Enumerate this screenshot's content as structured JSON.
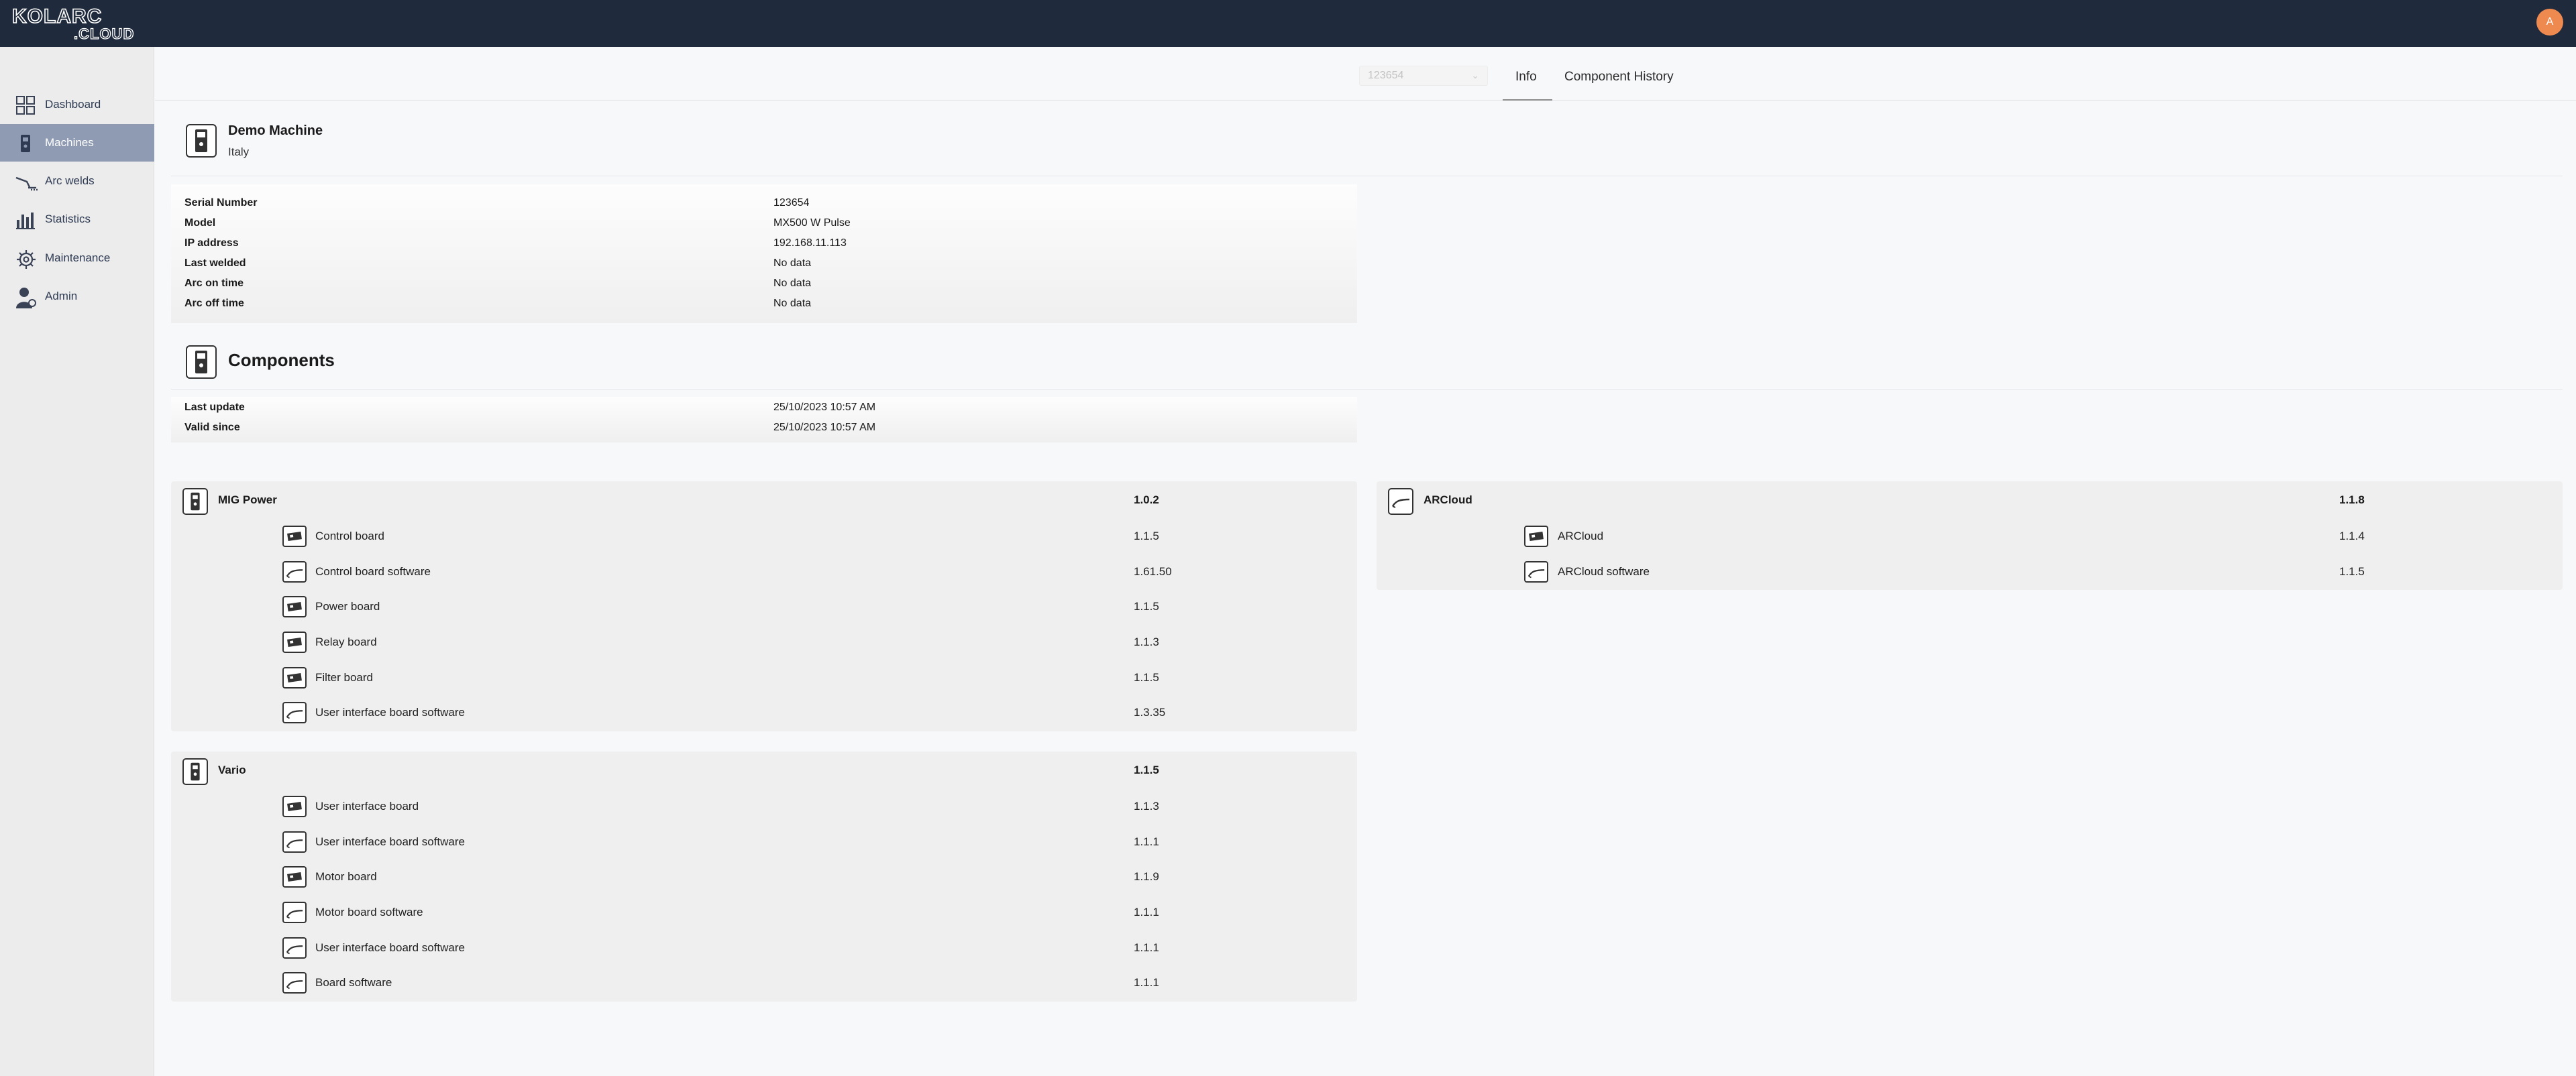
{
  "app": {
    "logo_text": "KOLARC.CLOUD",
    "user_initial": "A"
  },
  "sidebar": {
    "items": [
      {
        "label": "Dashboard",
        "icon": "dashboard-grid-icon"
      },
      {
        "label": "Machines",
        "icon": "machine-icon",
        "active": true
      },
      {
        "label": "Arc welds",
        "icon": "welding-torch-icon"
      },
      {
        "label": "Statistics",
        "icon": "bar-chart-icon"
      },
      {
        "label": "Maintenance",
        "icon": "gear-wrench-icon"
      },
      {
        "label": "Admin",
        "icon": "user-admin-icon"
      }
    ]
  },
  "header": {
    "machine_select_value": "123654",
    "tabs": [
      {
        "label": "Info",
        "active": true
      },
      {
        "label": "Component History",
        "active": false
      }
    ]
  },
  "machine": {
    "name": "Demo Machine",
    "country": "Italy",
    "details": [
      {
        "label": "Serial Number",
        "value": "123654"
      },
      {
        "label": "Model",
        "value": "MX500 W Pulse"
      },
      {
        "label": "IP address",
        "value": "192.168.11.113"
      },
      {
        "label": "Last welded",
        "value": "No data"
      },
      {
        "label": "Arc on time",
        "value": "No data"
      },
      {
        "label": "Arc off time",
        "value": "No data"
      }
    ]
  },
  "components": {
    "title": "Components",
    "meta": [
      {
        "label": "Last update",
        "value": "25/10/2023 10:57 AM"
      },
      {
        "label": "Valid since",
        "value": "25/10/2023 10:57 AM"
      }
    ],
    "groups": [
      {
        "name": "MIG Power",
        "version": "1.0.2",
        "items": [
          {
            "name": "Control board",
            "version": "1.1.5",
            "icon": "circuit-board-icon"
          },
          {
            "name": "Control board software",
            "version": "1.61.50",
            "icon": "software-icon"
          },
          {
            "name": "Power board",
            "version": "1.1.5",
            "icon": "circuit-board-icon"
          },
          {
            "name": "Relay board",
            "version": "1.1.3",
            "icon": "circuit-board-icon"
          },
          {
            "name": "Filter board",
            "version": "1.1.5",
            "icon": "circuit-board-icon"
          },
          {
            "name": "User interface board software",
            "version": "1.3.35",
            "icon": "software-icon"
          }
        ]
      },
      {
        "name": "Vario",
        "version": "1.1.5",
        "items": [
          {
            "name": "User interface board",
            "version": "1.1.3",
            "icon": "circuit-board-icon"
          },
          {
            "name": "User interface board software",
            "version": "1.1.1",
            "icon": "software-icon"
          },
          {
            "name": "Motor board",
            "version": "1.1.9",
            "icon": "circuit-board-icon"
          },
          {
            "name": "Motor board software",
            "version": "1.1.1",
            "icon": "software-icon"
          },
          {
            "name": "User interface board software",
            "version": "1.1.1",
            "icon": "software-icon"
          },
          {
            "name": "Board software",
            "version": "1.1.1",
            "icon": "software-icon"
          }
        ]
      },
      {
        "name": "ARCloud",
        "version": "1.1.8",
        "items": [
          {
            "name": "ARCloud",
            "version": "1.1.4",
            "icon": "circuit-board-icon"
          },
          {
            "name": "ARCloud software",
            "version": "1.1.5",
            "icon": "software-icon"
          }
        ]
      }
    ]
  }
}
